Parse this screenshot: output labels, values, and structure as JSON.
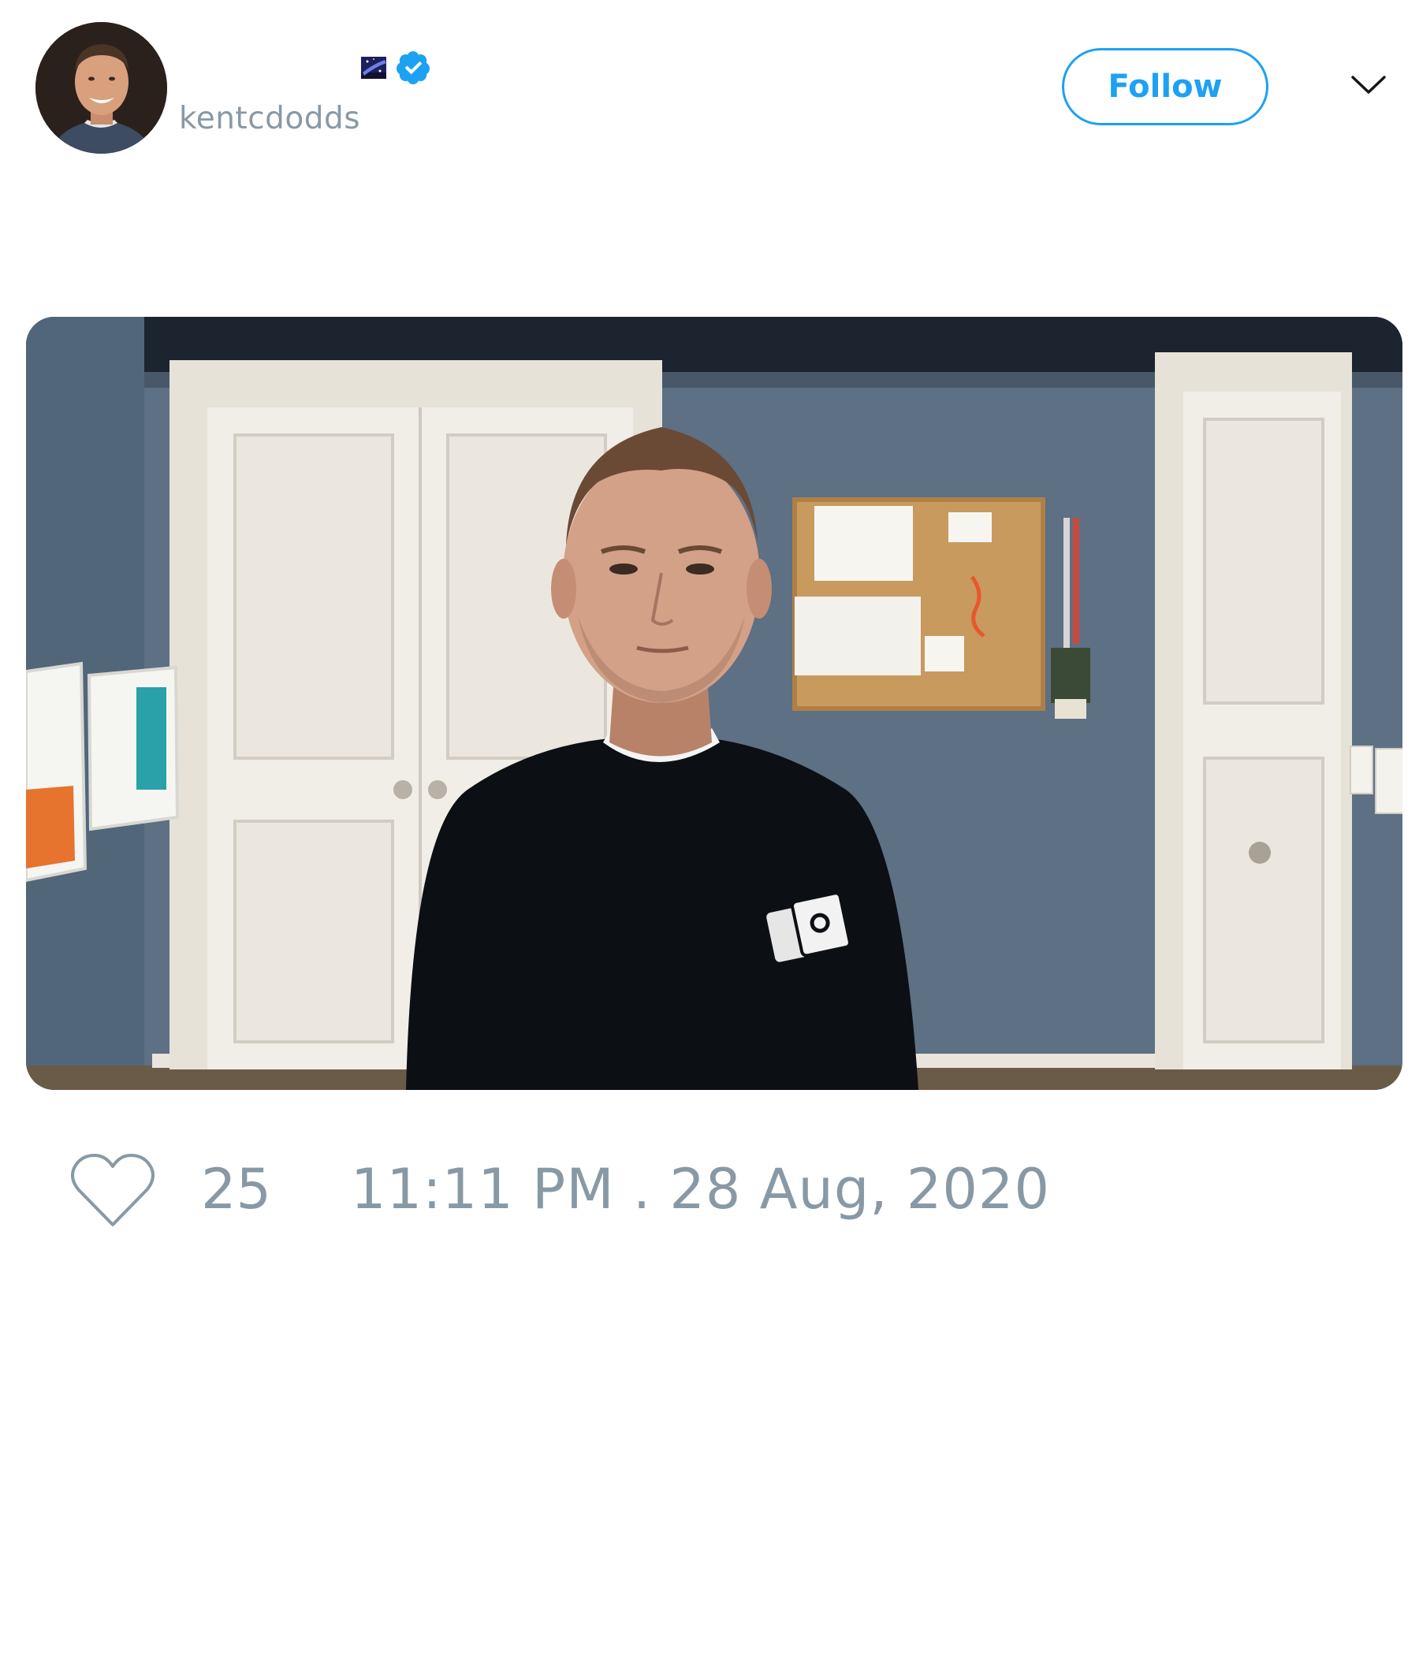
{
  "author": {
    "handle": "kentcdodds",
    "avatar_icon": "profile-photo",
    "badges": [
      "galaxy-emoji",
      "verified-badge-icon"
    ]
  },
  "header": {
    "follow_label": "Follow",
    "menu_icon": "chevron-down-icon"
  },
  "media": {
    "kind": "animated-gif",
    "subject": "person-in-black-tshirt"
  },
  "stats": {
    "like_icon": "heart-outline-icon",
    "like_count": "25",
    "timestamp": "11:11 PM . 28 Aug, 2020"
  },
  "colors": {
    "accent": "#1da1f2",
    "muted_text": "#8899a6",
    "background": "#ffffff"
  }
}
